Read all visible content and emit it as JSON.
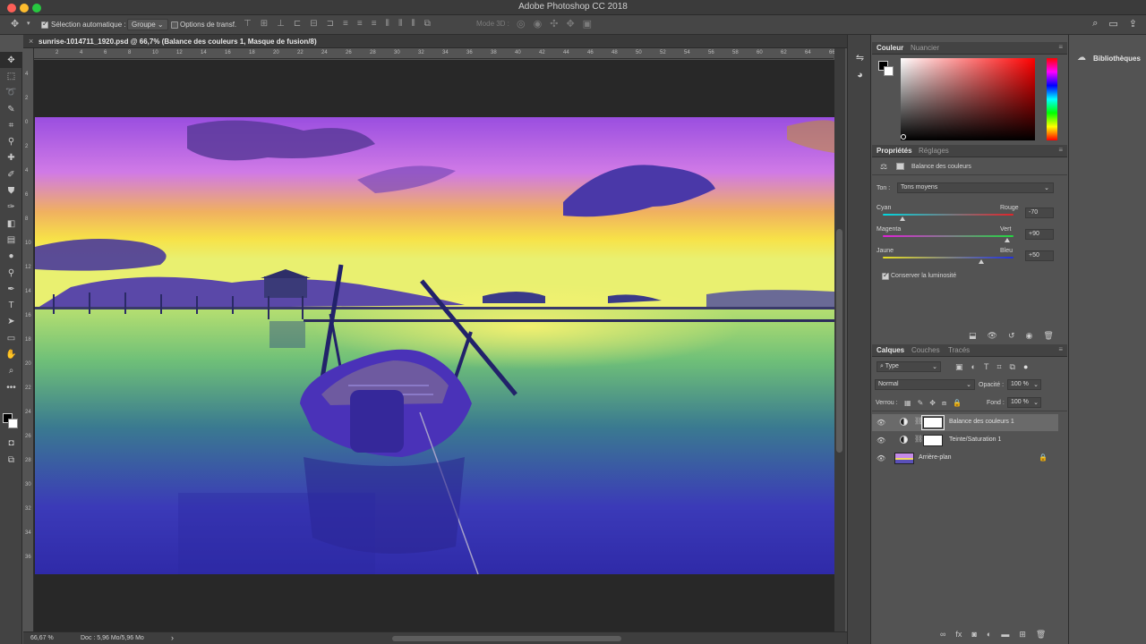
{
  "window": {
    "title": "Adobe Photoshop CC 2018"
  },
  "options_bar": {
    "auto_select_label": "Sélection automatique :",
    "auto_select_value": "Groupe",
    "transform_label": "Options de transf.",
    "mode_3d_label": "Mode 3D :"
  },
  "document": {
    "tab_close": "×",
    "tab_title": "sunrise-1014711_1920.psd @ 66,7% (Balance des couleurs 1, Masque de fusion/8)",
    "ruler_h_ticks": [
      "2",
      "4",
      "6",
      "8",
      "10",
      "12",
      "14",
      "16",
      "18",
      "20",
      "22",
      "24",
      "26",
      "28",
      "30",
      "32",
      "34",
      "36",
      "38",
      "40",
      "42",
      "44",
      "46",
      "48",
      "50",
      "52",
      "54",
      "56",
      "58",
      "60",
      "62",
      "64",
      "66"
    ],
    "ruler_v_ticks": [
      "4",
      "2",
      "0",
      "2",
      "4",
      "6",
      "8",
      "10",
      "12",
      "14",
      "16",
      "18",
      "20",
      "22",
      "24",
      "26",
      "28",
      "30",
      "32",
      "34",
      "36"
    ]
  },
  "status_bar": {
    "zoom": "66,67 %",
    "doc_info": "Doc : 5,96 Mo/5,96 Mo",
    "arrow": "›"
  },
  "color_panel": {
    "tabs": [
      "Couleur",
      "Nuancier"
    ],
    "base_hue": "#ff0000"
  },
  "libraries_panel": {
    "label": "Bibliothèques"
  },
  "properties_panel": {
    "tabs": [
      "Propriétés",
      "Réglages"
    ],
    "title": "Balance des couleurs",
    "tone_label": "Ton :",
    "tone_value": "Tons moyens",
    "sliders": [
      {
        "left": "Cyan",
        "right": "Rouge",
        "value": "-70",
        "amount": -70,
        "track_from": "#00d8e0",
        "track_to": "#e0242a"
      },
      {
        "left": "Magenta",
        "right": "Vert",
        "value": "+90",
        "amount": 90,
        "track_from": "#e020d8",
        "track_to": "#22d840"
      },
      {
        "left": "Jaune",
        "right": "Bleu",
        "value": "+50",
        "amount": 50,
        "track_from": "#e8e020",
        "track_to": "#2030e0"
      }
    ],
    "preserve_label": "Conserver la luminosité"
  },
  "layers_panel": {
    "tabs": [
      "Calques",
      "Couches",
      "Tracés"
    ],
    "filter_label": "Type",
    "blend_mode": "Normal",
    "opacity_label": "Opacité :",
    "opacity_value": "100 %",
    "lock_label": "Verrou :",
    "fill_label": "Fond :",
    "fill_value": "100 %",
    "layers": [
      {
        "name": "Balance des couleurs 1",
        "selected": true
      },
      {
        "name": "Teinte/Saturation 1",
        "selected": false
      },
      {
        "name": "Arrière-plan",
        "selected": false
      }
    ]
  }
}
